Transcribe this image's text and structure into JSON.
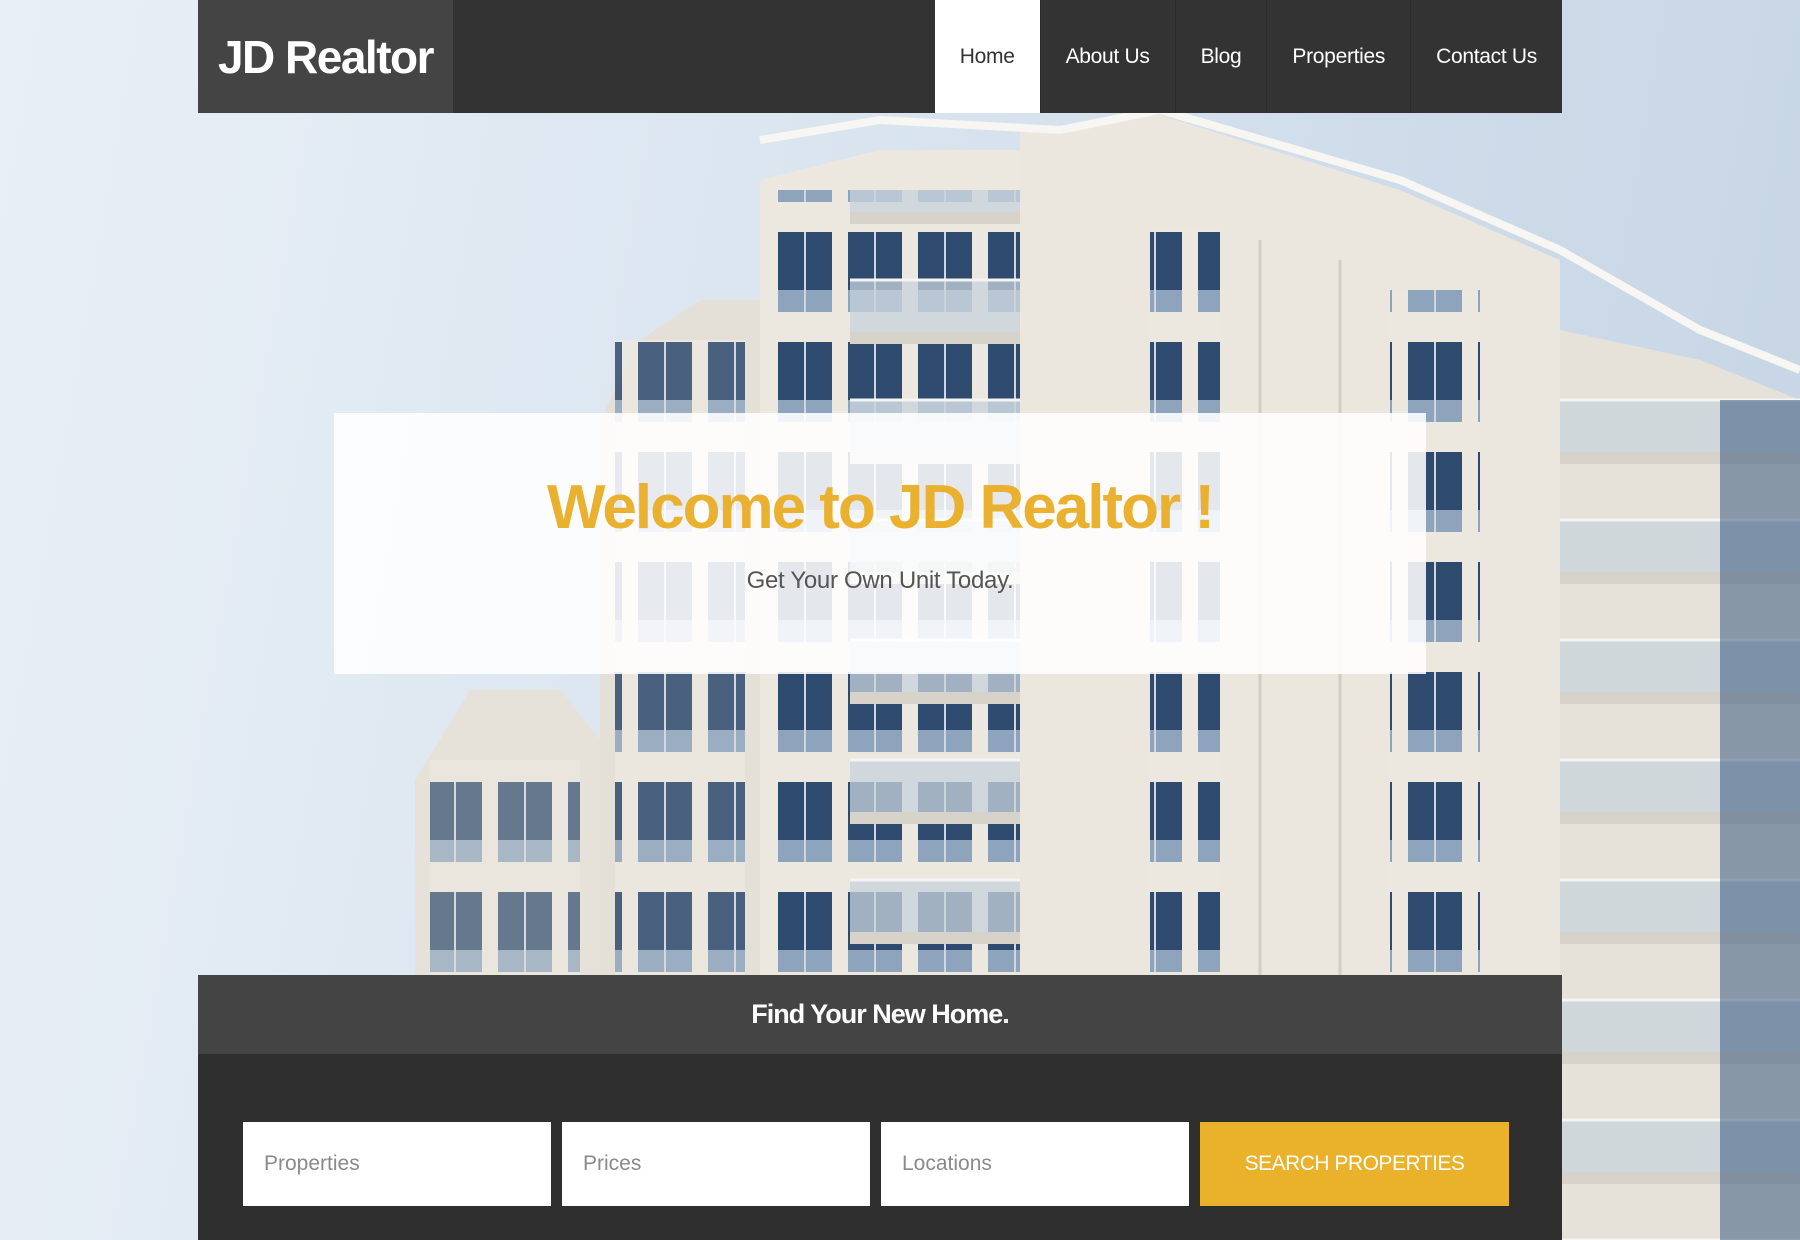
{
  "header": {
    "logo": "JD Realtor",
    "nav": [
      {
        "label": "Home",
        "active": true
      },
      {
        "label": "About Us",
        "active": false
      },
      {
        "label": "Blog",
        "active": false
      },
      {
        "label": "Properties",
        "active": false
      },
      {
        "label": "Contact Us",
        "active": false
      }
    ]
  },
  "hero": {
    "title": "Welcome to JD Realtor !",
    "subtitle": "Get Your Own Unit Today."
  },
  "search": {
    "heading": "Find Your New Home.",
    "properties_placeholder": "Properties",
    "prices_placeholder": "Prices",
    "locations_placeholder": "Locations",
    "button_label": "SEARCH PROPERTIES"
  },
  "colors": {
    "accent": "#eab130",
    "header_bg": "#333333",
    "logo_bg": "#444444"
  }
}
